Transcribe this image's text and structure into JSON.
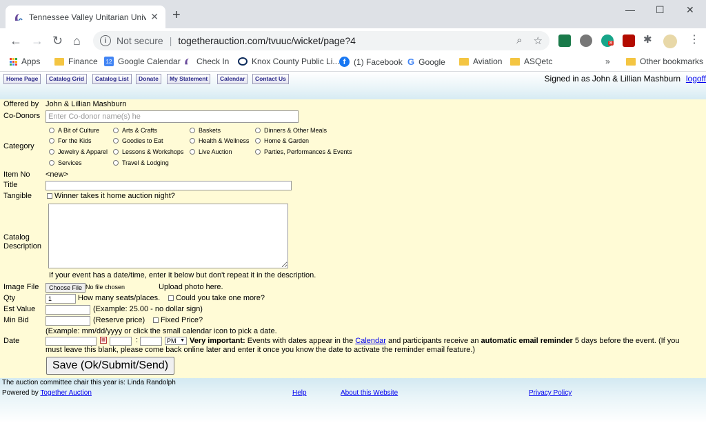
{
  "browser": {
    "tab_title": "Tennessee Valley Unitarian Universa",
    "new_tab": "+",
    "omnibox": {
      "security": "Not secure",
      "url": "togetherauction.com/tvuuc/wicket/page?4"
    },
    "bookmarks": [
      {
        "label": "Apps"
      },
      {
        "label": "Finance"
      },
      {
        "label": "Google Calendar"
      },
      {
        "label": "Check In"
      },
      {
        "label": "Knox County Public Li..."
      },
      {
        "label": "(1) Facebook"
      },
      {
        "label": "Google"
      },
      {
        "label": "Aviation"
      },
      {
        "label": "ASQetc"
      }
    ],
    "bookmarks_more": "»",
    "other_bookmarks": "Other bookmarks",
    "ext_badge": "8",
    "colors": {
      "tabbar": "#dee1e6",
      "folder": "#f4c542"
    }
  },
  "nav": {
    "items": [
      "Home Page",
      "Catalog Grid",
      "Catalog List",
      "Donate",
      "My Statement",
      "Calendar",
      "Contact Us"
    ],
    "signed_in": "Signed in as John & Lillian Mashburn",
    "logoff": "logoff"
  },
  "form": {
    "offered_by_label": "Offered by",
    "offered_by_value": "John & Lillian Mashburn",
    "codonors_label": "Co-Donors",
    "codonors_placeholder": "Enter Co-donor name(s) he",
    "category_label": "Category",
    "categories": [
      "A Bit of Culture",
      "Arts & Crafts",
      "Baskets",
      "Dinners & Other Meals",
      "For the Kids",
      "Goodies to Eat",
      "Health & Wellness",
      "Home & Garden",
      "Jewelry & Apparel",
      "Lessons & Workshops",
      "Live Auction",
      "Parties, Performances & Events",
      "Services",
      "Travel & Lodging"
    ],
    "item_no_label": "Item No",
    "item_no_value": "<new>",
    "title_label": "Title",
    "tangible_label": "Tangible",
    "tangible_text": "Winner takes it home auction night?",
    "catalog_label_1": "Catalog",
    "catalog_label_2": "Description",
    "date_hint": "If your event has a date/time, enter it below but don't repeat it in the description.",
    "image_label": "Image File",
    "choose_file": "Choose File",
    "no_file": "No file chosen",
    "upload_hint": "Upload photo here.",
    "qty_label": "Qty",
    "qty_value": "1",
    "qty_text": "How many seats/places.",
    "take_more": "Could you take one more?",
    "est_label": "Est Value",
    "est_text": "(Example: 25.00 - no dollar sign)",
    "min_label": "Min Bid",
    "min_text": "(Reserve price)",
    "fixed_price": "Fixed Price?",
    "date_example": "(Example: mm/dd/yyyy or click the small calendar icon to pick a date.",
    "date_label": "Date",
    "ampm": "PM",
    "very_important": "Very important:",
    "events_text": "Events with dates appear in the",
    "calendar_link": "Calendar",
    "and_text": "and participants receive an",
    "auto_email": "automatic email reminder",
    "days_text": "5 days before the event.  (If you",
    "blank_text": "must leave this blank, please come back online later and enter it once you know the date to activate the reminder email feature.)",
    "save": "Save (Ok/Submit/Send)"
  },
  "footer": {
    "chair": "The auction committee chair this year is: Linda Randolph",
    "powered": "Powered by",
    "together": "Together Auction",
    "help": "Help",
    "about": "About this Website",
    "privacy": "Privacy Policy"
  }
}
